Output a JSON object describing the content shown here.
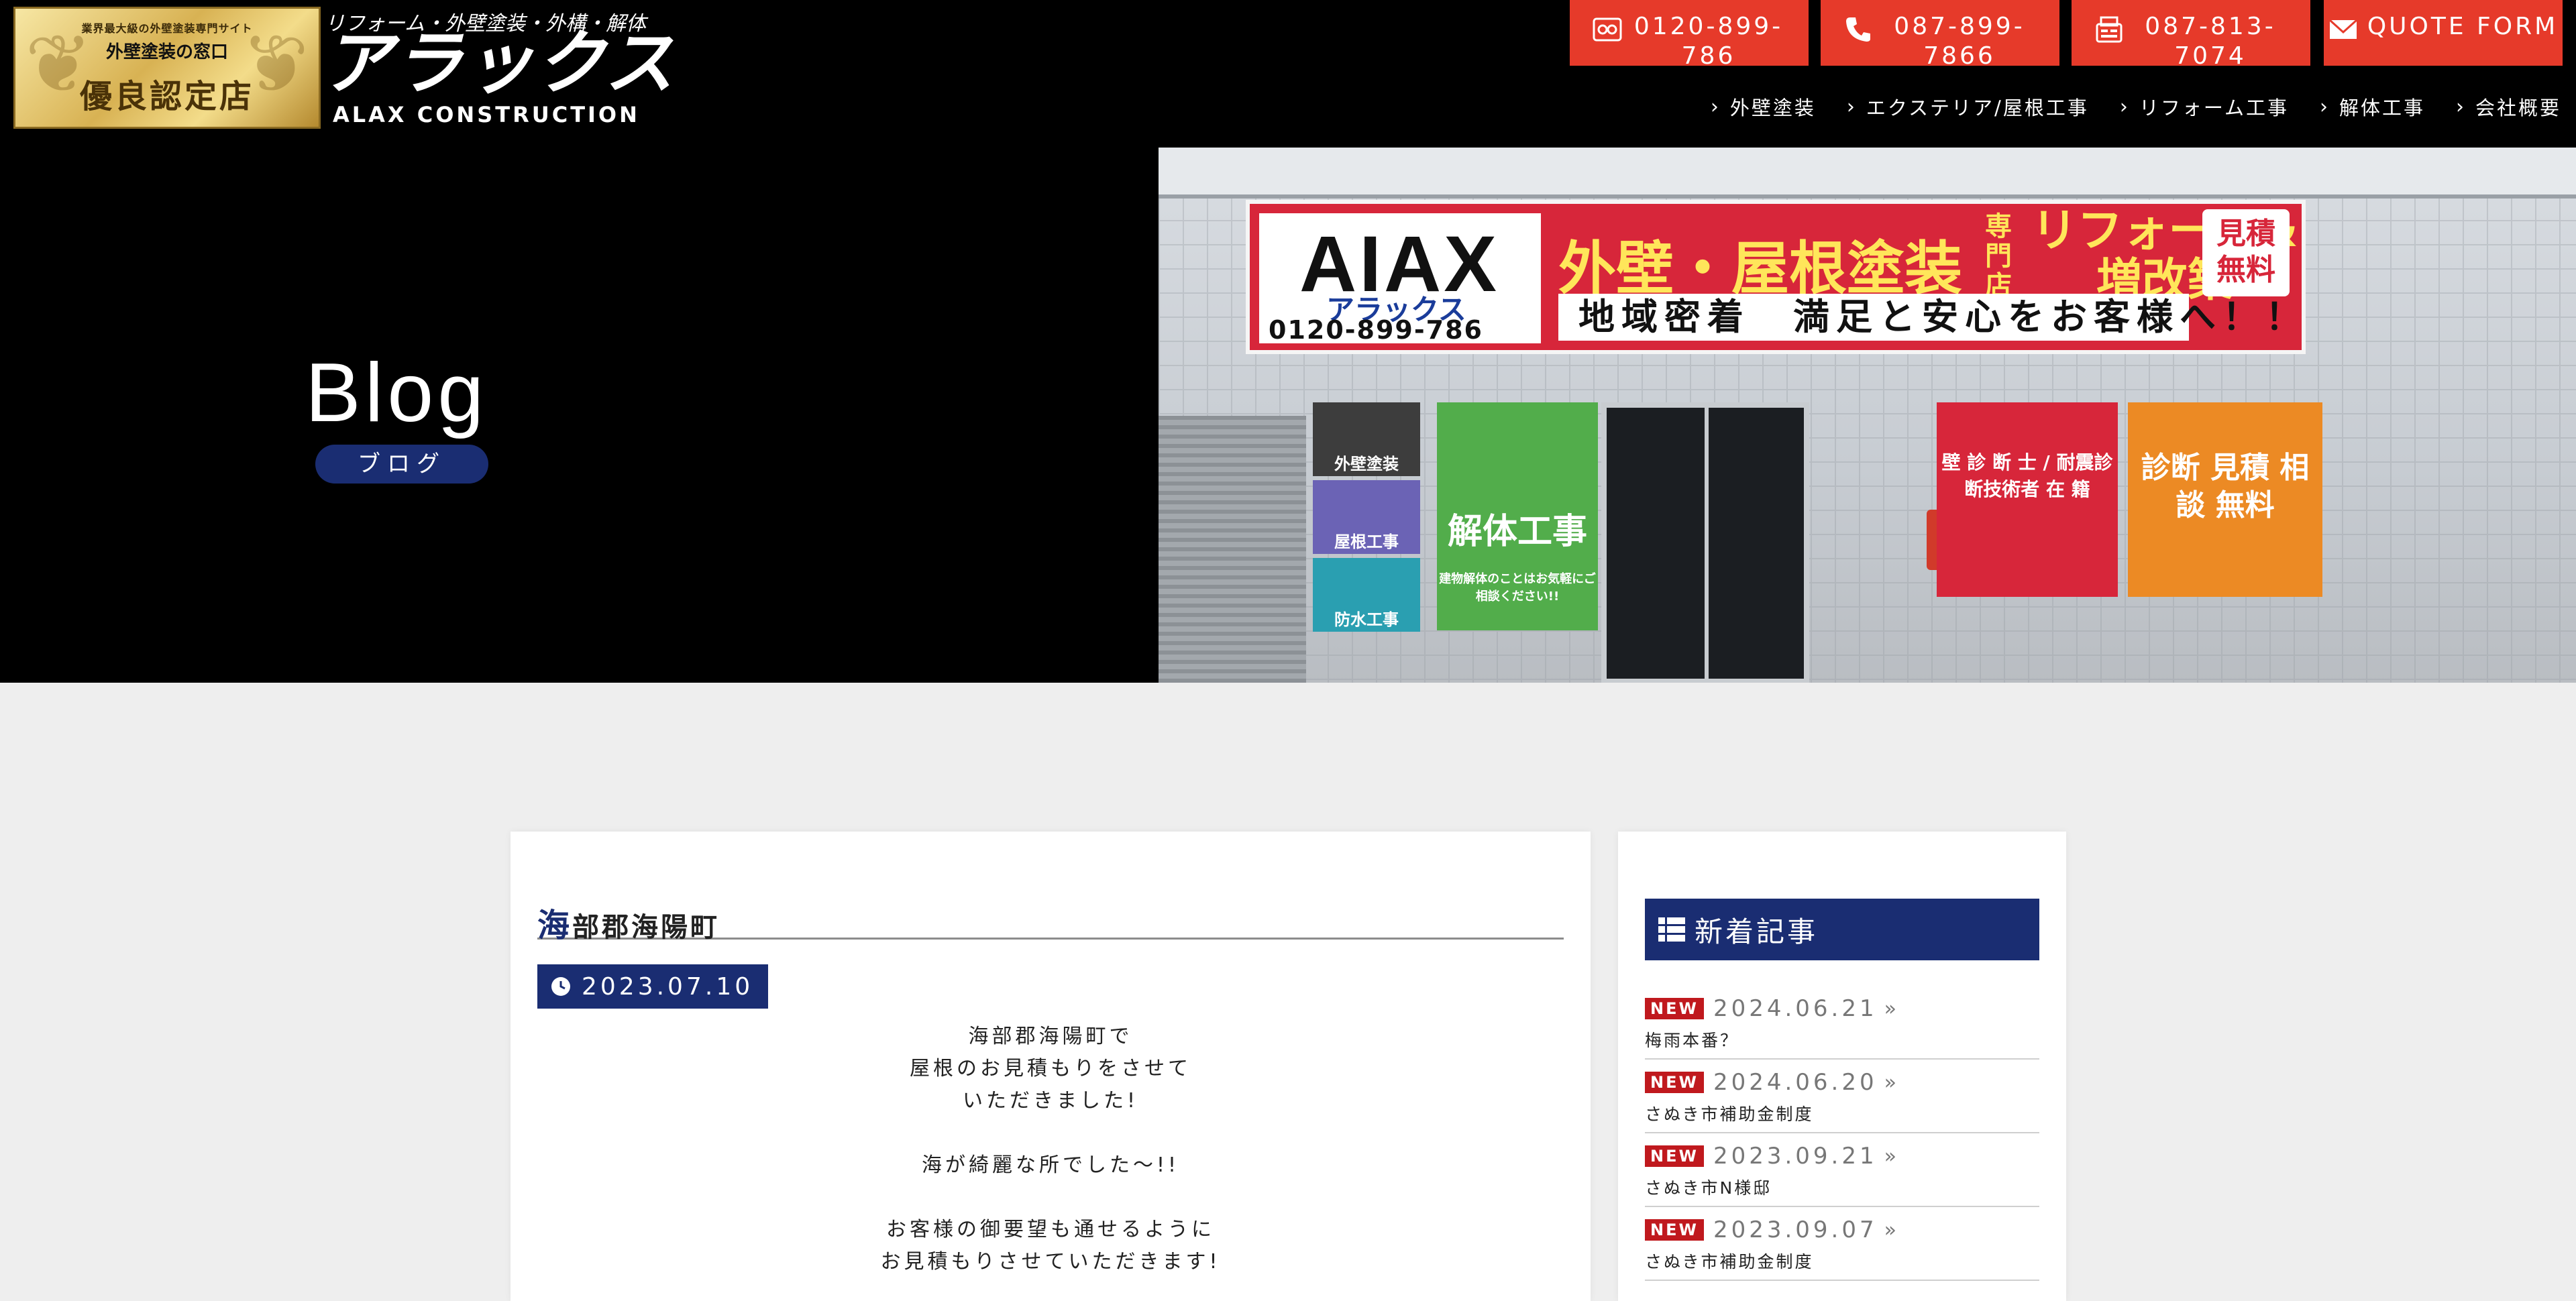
{
  "header": {
    "badge": {
      "small": "業界最大級の外壁塗装専門サイト",
      "mid": "外壁塗装の窓口",
      "big": "優良認定店"
    },
    "logo": {
      "tagline": "リフォーム・外壁塗装・外構・解体",
      "name": "アラックス",
      "sub": "ALAX CONSTRUCTION"
    },
    "cta": [
      {
        "label": "0120-899-786",
        "icon": "free-dial-icon"
      },
      {
        "label": "087-899-7866",
        "icon": "phone-icon"
      },
      {
        "label": "087-813-7074",
        "icon": "fax-icon"
      },
      {
        "label": "QUOTE FORM",
        "icon": "mail-icon"
      }
    ],
    "nav": [
      "外壁塗装",
      "エクステリア/屋根工事",
      "リフォーム工事",
      "解体工事",
      "会社概要"
    ]
  },
  "hero": {
    "title": "Blog",
    "subtitle": "ブログ",
    "photo_sign": {
      "brand": "AIAX",
      "brand_kana": "アラックス",
      "phone": "0120-899-786",
      "headline": "外壁・屋根塗装",
      "senmon": "専門店",
      "reform": "リフォーム& 増改築",
      "estimate": "見積無料",
      "slogan": "地域密着　満足と安心をお客様へ！！",
      "panels": [
        "外壁塗装",
        "屋根工事",
        "防水工事"
      ],
      "demolition": "解体工事",
      "demolition_note": "建物解体のことはお気軽にご相談ください!!",
      "qualifications": "壁 診 断 士 / 耐震診断技術者 在 籍",
      "free_consult": "診断 見積 相談 無料"
    }
  },
  "post": {
    "title_first": "海",
    "title_rest": "部郡海陽町",
    "date": "2023.07.10",
    "body": [
      "海部郡海陽町で",
      "屋根のお見積もりをさせて",
      "いただきました!",
      "",
      "海が綺麗な所でした〜!!",
      "",
      "お客様の御要望も通せるように",
      "お見積もりさせていただきます!"
    ]
  },
  "sidebar": {
    "heading": "新着記事",
    "new_label": "NEW",
    "items": [
      {
        "date": "2024.06.21",
        "title": "梅雨本番？"
      },
      {
        "date": "2024.06.20",
        "title": "さぬき市補助金制度"
      },
      {
        "date": "2023.09.21",
        "title": "さぬき市N様邸"
      },
      {
        "date": "2023.09.07",
        "title": "さぬき市補助金制度"
      }
    ]
  },
  "colors": {
    "accent_red": "#e63a2a",
    "navy": "#1a2d72",
    "new_badge": "#c0191e"
  }
}
